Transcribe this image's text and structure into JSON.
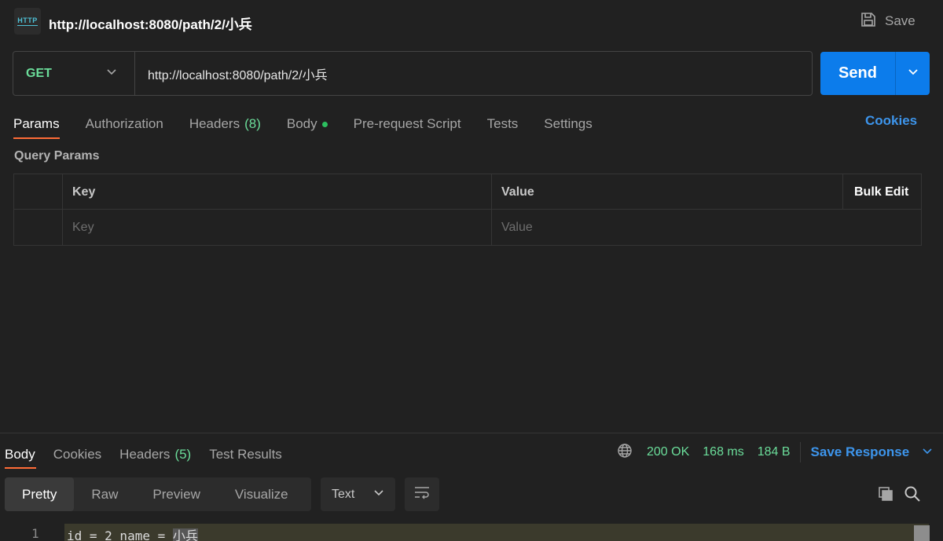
{
  "header": {
    "icon_text": "HTTP",
    "title": "http://localhost:8080/path/2/小兵",
    "save_label": "Save"
  },
  "request": {
    "method": "GET",
    "url": "http://localhost:8080/path/2/小兵",
    "send_label": "Send"
  },
  "request_tabs": [
    {
      "label": "Params",
      "active": true
    },
    {
      "label": "Authorization"
    },
    {
      "label": "Headers",
      "count": "(8)"
    },
    {
      "label": "Body",
      "indicator": "green-dot"
    },
    {
      "label": "Pre-request Script"
    },
    {
      "label": "Tests"
    },
    {
      "label": "Settings"
    }
  ],
  "cookies_link": "Cookies",
  "query_params": {
    "title": "Query Params",
    "columns": {
      "key": "Key",
      "value": "Value",
      "bulk_edit": "Bulk Edit"
    },
    "placeholders": {
      "key": "Key",
      "value": "Value"
    }
  },
  "response": {
    "tabs": [
      {
        "label": "Body",
        "active": true
      },
      {
        "label": "Cookies"
      },
      {
        "label": "Headers",
        "count": "(5)"
      },
      {
        "label": "Test Results"
      }
    ],
    "status": "200 OK",
    "time": "168 ms",
    "size": "184 B",
    "save_response_label": "Save Response",
    "view_modes": [
      "Pretty",
      "Raw",
      "Preview",
      "Visualize"
    ],
    "active_view_mode": "Pretty",
    "format": "Text",
    "lines": [
      {
        "number": "1",
        "text_before": "id = 2 name = ",
        "text_selected": "小兵"
      }
    ]
  },
  "colors": {
    "accent_blue": "#0c7ceb",
    "link_blue": "#3d95ec",
    "method_green": "#6bdd9a",
    "active_tab_underline": "#ff6c37",
    "background": "#212121"
  }
}
